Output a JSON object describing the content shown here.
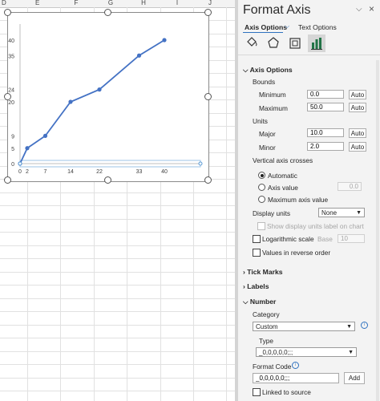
{
  "sheet": {
    "columns": [
      "D",
      "E",
      "F",
      "G",
      "H",
      "I",
      "J"
    ]
  },
  "chart_data": {
    "type": "line",
    "x": [
      0,
      2,
      7,
      14,
      22,
      33,
      40
    ],
    "y": [
      0,
      5,
      9,
      20,
      24,
      35,
      40
    ],
    "x_tick_labels": [
      "0",
      "2",
      "7",
      "14",
      "22",
      "33",
      "40"
    ],
    "y_tick_labels": [
      "0",
      "5",
      "9",
      "20",
      "24",
      "35",
      "40"
    ],
    "xlim": [
      0,
      50
    ],
    "ylim": [
      0,
      40
    ],
    "line_color": "#4472c4",
    "grid": false
  },
  "pane": {
    "title": "Format Axis",
    "close": "×",
    "options_dropdown": "⌵",
    "tabs": {
      "axis_options": "Axis Options",
      "text_options": "Text Options"
    },
    "icons": [
      "fill-line-icon",
      "effects-icon",
      "size-properties-icon",
      "axis-options-icon"
    ],
    "axis_options_section": "Axis Options",
    "bounds_label": "Bounds",
    "minimum_label": "Minimum",
    "minimum_value": "0.0",
    "maximum_label": "Maximum",
    "maximum_value": "50.0",
    "auto_label": "Auto",
    "units_label": "Units",
    "major_label": "Major",
    "major_value": "10.0",
    "minor_label": "Minor",
    "minor_value": "2.0",
    "vaxis_crosses_label": "Vertical axis crosses",
    "automatic_label": "Automatic",
    "axis_value_label": "Axis value",
    "axis_value_value": "0.0",
    "max_axis_value_label": "Maximum axis value",
    "display_units_label": "Display units",
    "display_units_value": "None",
    "show_units_label": "Show display units label on chart",
    "log_scale_label": "Logarithmic scale",
    "base_label": "Base",
    "base_value": "10",
    "reverse_label": "Values in reverse order",
    "tick_marks_section": "Tick Marks",
    "labels_section": "Labels",
    "number_section": "Number",
    "category_label": "Category",
    "category_value": "Custom",
    "type_label": "Type",
    "type_value": "_0,0,0,0,0;;;",
    "format_code_label": "Format Code",
    "format_code_value": "_0,0,0,0,0;;;",
    "add_label": "Add",
    "linked_label": "Linked to source"
  }
}
